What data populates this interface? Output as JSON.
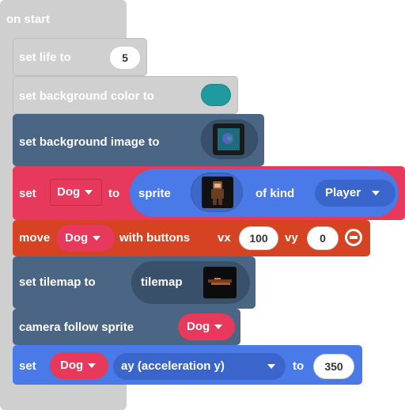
{
  "event": {
    "label": "on start"
  },
  "blocks": {
    "set_life": {
      "label": "set life to",
      "value": "5"
    },
    "set_bg_color": {
      "label": "set background color to",
      "color": "#1f9a9e"
    },
    "set_bg_image": {
      "label": "set background image to"
    },
    "set_sprite": {
      "set": "set",
      "variable": "Dog",
      "to": "to",
      "sprite": "sprite",
      "of_kind": "of kind",
      "kind": "Player"
    },
    "move": {
      "label": "move",
      "variable": "Dog",
      "with_buttons": "with buttons",
      "vx_label": "vx",
      "vx": "100",
      "vy_label": "vy",
      "vy": "0"
    },
    "set_tilemap": {
      "label": "set tilemap to",
      "tilemap": "tilemap"
    },
    "camera": {
      "label": "camera follow sprite",
      "variable": "Dog"
    },
    "set_accel": {
      "set": "set",
      "variable": "Dog",
      "property": "ay (acceleration y)",
      "to": "to",
      "value": "350"
    }
  },
  "colors": {
    "event_gray": "#cfcfcf",
    "scene_slate": "#4b6584",
    "sprite_red": "#e6395c",
    "controller_orange": "#d54322",
    "sprite_blue": "#4a7ae8"
  }
}
